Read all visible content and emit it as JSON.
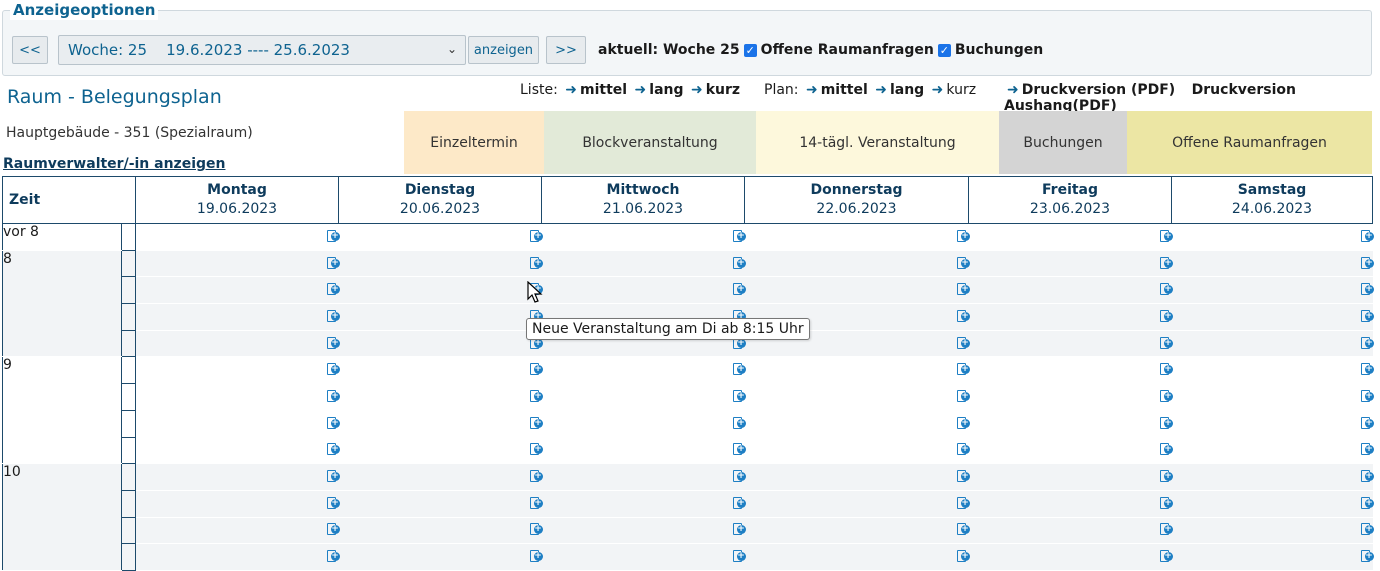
{
  "options": {
    "legend": "Anzeigeoptionen",
    "prev_label": "<<",
    "next_label": ">>",
    "week_select": "Woche: 25    19.6.2023 ---- 25.6.2023",
    "show_label": "anzeigen",
    "current_label": "aktuell: Woche 25",
    "checkbox1_label": "Offene Raumanfragen",
    "checkbox2_label": "Buchungen"
  },
  "page": {
    "title": "Raum - Belegungsplan",
    "list_label": "Liste:",
    "list_mittel": "mittel",
    "list_lang": "lang",
    "list_kurz": "kurz",
    "plan_label": "Plan:",
    "plan_mittel": "mittel",
    "plan_lang": "lang",
    "plan_kurz": "kurz",
    "druck": "Druckversion (PDF)",
    "druck_aushang": "Druckversion Aushang(PDF)",
    "building": "Hauptgebäude - 351 (Spezialraum)",
    "verwalter_link": "Raumverwalter/-in anzeigen"
  },
  "legend_items": [
    {
      "label": "Einzeltermin",
      "color": "#fde9c8"
    },
    {
      "label": "Blockveranstaltung",
      "color": "#e2ead8"
    },
    {
      "label": "14-tägl. Veranstaltung",
      "color": "#fdf8dc"
    },
    {
      "label": "Buchungen",
      "color": "#d4d4d4"
    },
    {
      "label": "Offene Raumanfragen",
      "color": "#ece6a4"
    }
  ],
  "table": {
    "time_header": "Zeit",
    "days": [
      {
        "name": "Montag",
        "date": "19.06.2023"
      },
      {
        "name": "Dienstag",
        "date": "20.06.2023"
      },
      {
        "name": "Mittwoch",
        "date": "21.06.2023"
      },
      {
        "name": "Donnerstag",
        "date": "22.06.2023"
      },
      {
        "name": "Freitag",
        "date": "23.06.2023"
      },
      {
        "name": "Samstag",
        "date": "24.06.2023"
      }
    ],
    "hours": [
      "vor 8",
      "8",
      "9",
      "10"
    ]
  },
  "tooltip": "Neue Veranstaltung am Di ab 8:15 Uhr",
  "icons": {
    "add_event": "add-event-icon",
    "cursor": "mouse-cursor-icon"
  },
  "colors": {
    "accent": "#0e6390",
    "border": "#1d4a6b"
  }
}
